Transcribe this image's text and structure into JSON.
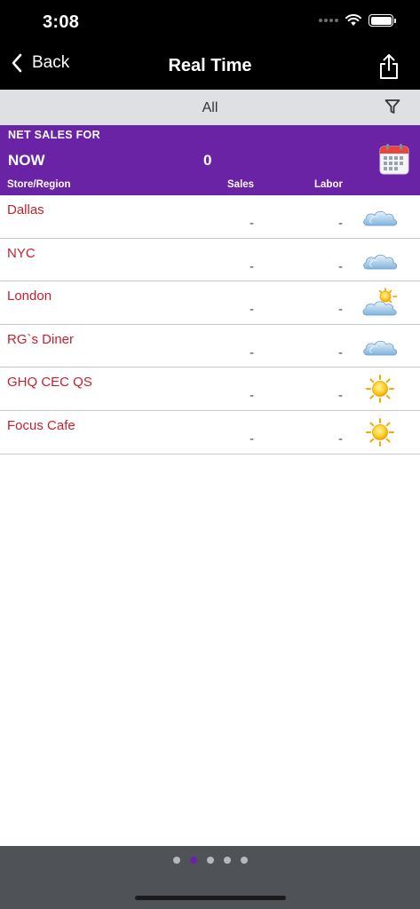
{
  "status_bar": {
    "time": "3:08"
  },
  "nav": {
    "back_label": "Back",
    "title": "Real Time"
  },
  "filter": {
    "label": "All"
  },
  "header": {
    "net_sales_title": "NET SALES FOR",
    "period": "NOW",
    "total": "0",
    "col_store": "Store/Region",
    "col_sales": "Sales",
    "col_labor": "Labor"
  },
  "stores": [
    {
      "name": "Dallas",
      "sales": "-",
      "labor": "-",
      "weather": "cloudy-icon"
    },
    {
      "name": "NYC",
      "sales": "-",
      "labor": "-",
      "weather": "cloudy-icon"
    },
    {
      "name": "London",
      "sales": "-",
      "labor": "-",
      "weather": "partly-sunny-icon"
    },
    {
      "name": "RG`s Diner",
      "sales": "-",
      "labor": "-",
      "weather": "cloudy-icon"
    },
    {
      "name": "GHQ CEC QS",
      "sales": "-",
      "labor": "-",
      "weather": "sunny-icon"
    },
    {
      "name": "Focus Cafe",
      "sales": "-",
      "labor": "-",
      "weather": "sunny-icon"
    }
  ],
  "pager": {
    "page_count": 5,
    "active_page": 2
  },
  "colors": {
    "accent": "#6b23a5",
    "store_name": "#c8202e",
    "nav_bg": "#000000",
    "filter_bg": "#dfe0e3",
    "pager_bg": "#4f5358"
  }
}
